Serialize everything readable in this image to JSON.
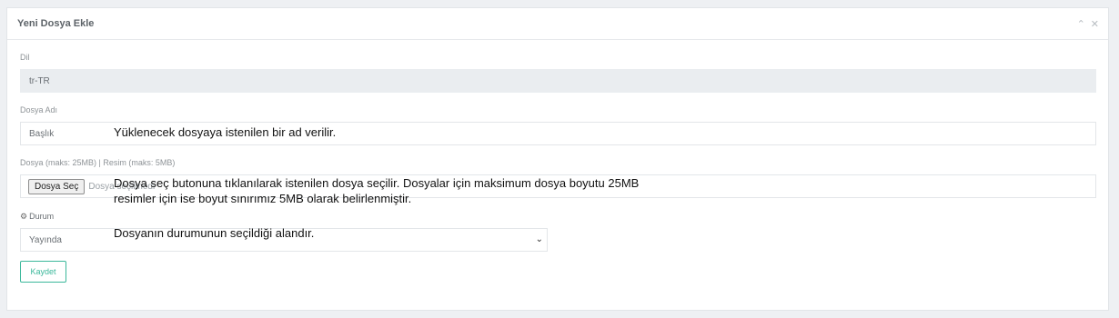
{
  "panel": {
    "title": "Yeni Dosya Ekle",
    "collapse_icon": "chevron-up-icon",
    "close_icon": "close-icon"
  },
  "form": {
    "language": {
      "label": "Dil",
      "value": "tr-TR"
    },
    "file_name": {
      "label": "Dosya Adı",
      "placeholder": "Başlık"
    },
    "file": {
      "label": "Dosya (maks: 25MB) | Resim (maks: 5MB)",
      "button": "Dosya Seç",
      "status": "Dosya seçilmedi"
    },
    "status": {
      "label": "Durum",
      "icon": "gear-icon",
      "selected": "Yayında"
    },
    "save_label": "Kaydet"
  },
  "annotations": {
    "file_name_note": "Yüklenecek dosyaya istenilen bir ad verilir.",
    "file_note_line1": "Dosya seç butonuna tıklanılarak istenilen dosya seçilir. Dosyalar için maksimum dosya boyutu 25MB",
    "file_note_line2": "resimler için ise boyut sınırımız 5MB olarak belirlenmiştir.",
    "status_note": "Dosyanın durumunun seçildiği alandır."
  }
}
